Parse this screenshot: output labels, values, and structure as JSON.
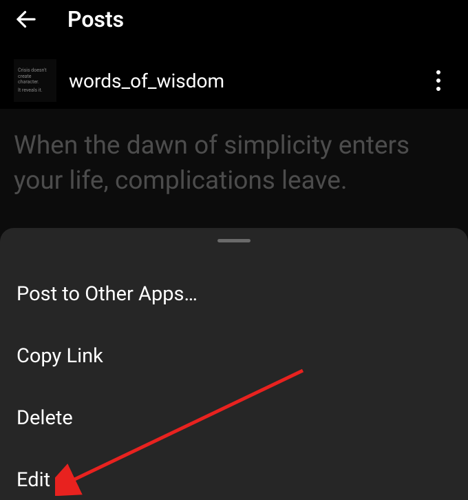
{
  "header": {
    "title": "Posts"
  },
  "post": {
    "username": "words_of_wisdom",
    "avatar_text_line1": "Crisis doesn't create character.",
    "avatar_text_line2": "It reveals it.",
    "content": "When the dawn of simplicity enters your life, complications leave."
  },
  "menu": {
    "post_to_other": "Post to Other Apps…",
    "copy_link": "Copy Link",
    "delete": "Delete",
    "edit": "Edit"
  }
}
